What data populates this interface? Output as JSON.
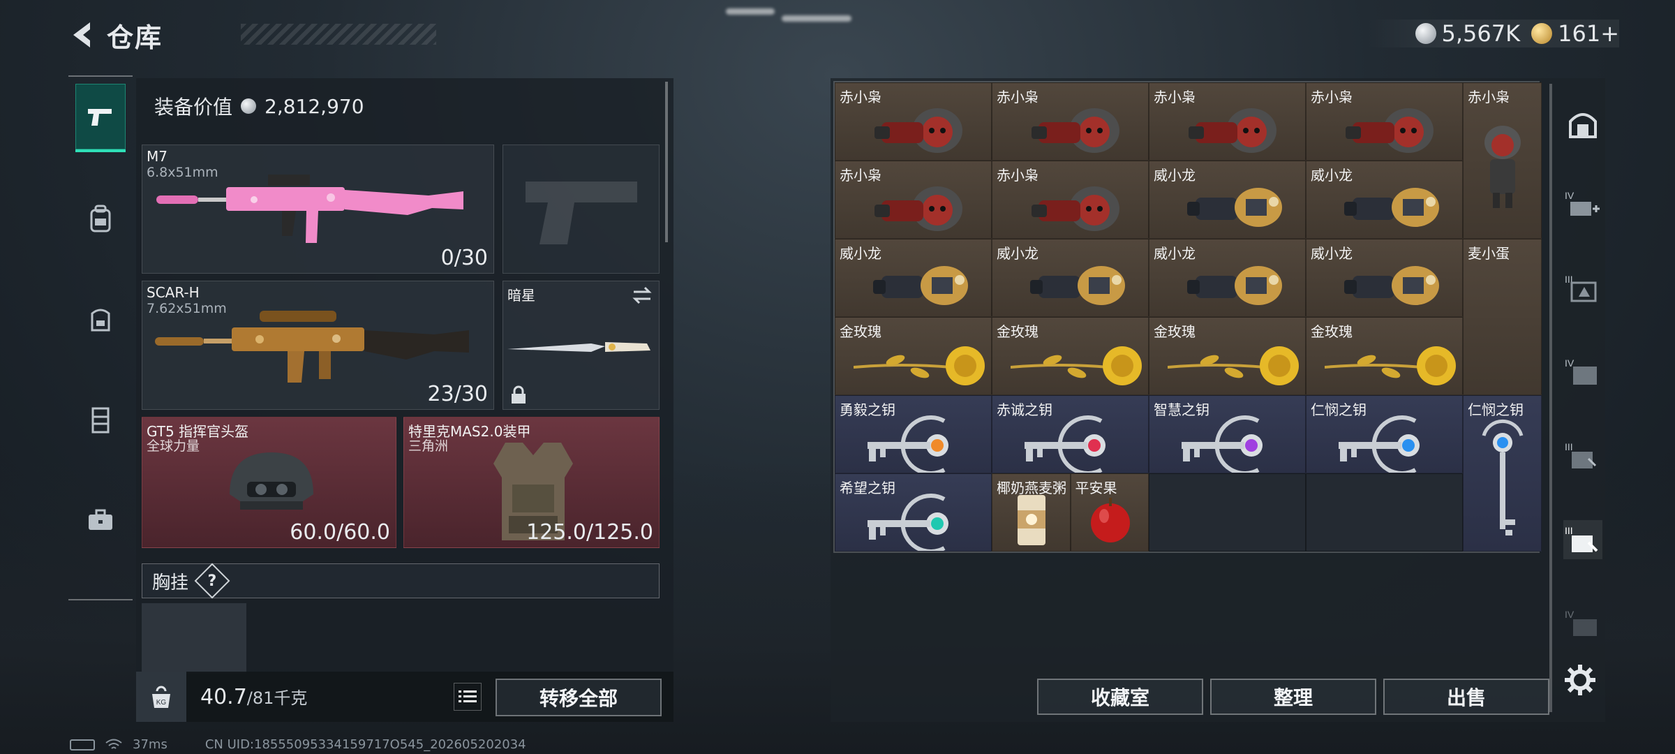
{
  "header": {
    "title": "仓库"
  },
  "currency": {
    "silver": "5,567K",
    "gold": "161+"
  },
  "rail": {
    "items": [
      "weapon-icon",
      "backpack-icon",
      "bag-icon",
      "vest-icon",
      "case-icon"
    ]
  },
  "loadout": {
    "equip_value_label": "装备价值",
    "equip_value": "2,812,970",
    "primary": {
      "name": "M7",
      "caliber": "6.8x51mm",
      "ammo": "0/30"
    },
    "secondary": {
      "name": "SCAR-H",
      "caliber": "7.62x51mm",
      "ammo": "23/30"
    },
    "melee": {
      "name": "暗星"
    },
    "helmet": {
      "name": "GT5 指挥官头盔",
      "sub": "全球力量",
      "durability": "60.0/60.0"
    },
    "armor": {
      "name": "特里克MAS2.0装甲",
      "sub": "三角洲",
      "durability": "125.0/125.0"
    },
    "chest_rig": {
      "label": "胸挂",
      "help": "?"
    },
    "weight": {
      "current": "40.7",
      "capacity": "/81千克"
    },
    "transfer_label": "转移全部"
  },
  "storage": {
    "items": [
      {
        "label": "赤小枭",
        "kind": "owl"
      },
      {
        "label": "赤小枭",
        "kind": "owl"
      },
      {
        "label": "赤小枭",
        "kind": "owl"
      },
      {
        "label": "赤小枭",
        "kind": "owl"
      },
      {
        "label": "赤小枭",
        "kind": "owl-tall"
      },
      {
        "label": "赤小枭",
        "kind": "owl"
      },
      {
        "label": "赤小枭",
        "kind": "owl"
      },
      {
        "label": "威小龙",
        "kind": "dragon"
      },
      {
        "label": "威小龙",
        "kind": "dragon"
      },
      {
        "label": "威小龙",
        "kind": "dragon"
      },
      {
        "label": "威小龙",
        "kind": "dragon"
      },
      {
        "label": "威小龙",
        "kind": "dragon"
      },
      {
        "label": "威小龙",
        "kind": "dragon"
      },
      {
        "label": "麦小蛋",
        "kind": "egg"
      },
      {
        "label": "金玫瑰",
        "kind": "rose"
      },
      {
        "label": "金玫瑰",
        "kind": "rose"
      },
      {
        "label": "金玫瑰",
        "kind": "rose"
      },
      {
        "label": "金玫瑰",
        "kind": "rose"
      },
      {
        "label": "勇毅之钥",
        "kind": "key",
        "gem": "#f08a2a"
      },
      {
        "label": "赤诚之钥",
        "kind": "key",
        "gem": "#e03050"
      },
      {
        "label": "智慧之钥",
        "kind": "key",
        "gem": "#a040e0"
      },
      {
        "label": "仁悯之钥",
        "kind": "key",
        "gem": "#2a90f0"
      },
      {
        "label": "仁悯之钥",
        "kind": "key-v",
        "gem": "#2a90f0"
      },
      {
        "label": "希望之钥",
        "kind": "key",
        "gem": "#20c8b0"
      },
      {
        "label": "椰奶燕麦粥",
        "kind": "can"
      },
      {
        "label": "平安果",
        "kind": "apple"
      }
    ]
  },
  "buttons": {
    "collection": "收藏室",
    "sort": "整理",
    "sell": "出售"
  },
  "status": {
    "ping": "37ms",
    "uid": "CN UID:18555095334159717O545_202605202034"
  },
  "colors": {
    "accent": "#2fe0b8",
    "brown": "#4a4035",
    "navy": "#30354d",
    "red": "#5a2c34"
  }
}
